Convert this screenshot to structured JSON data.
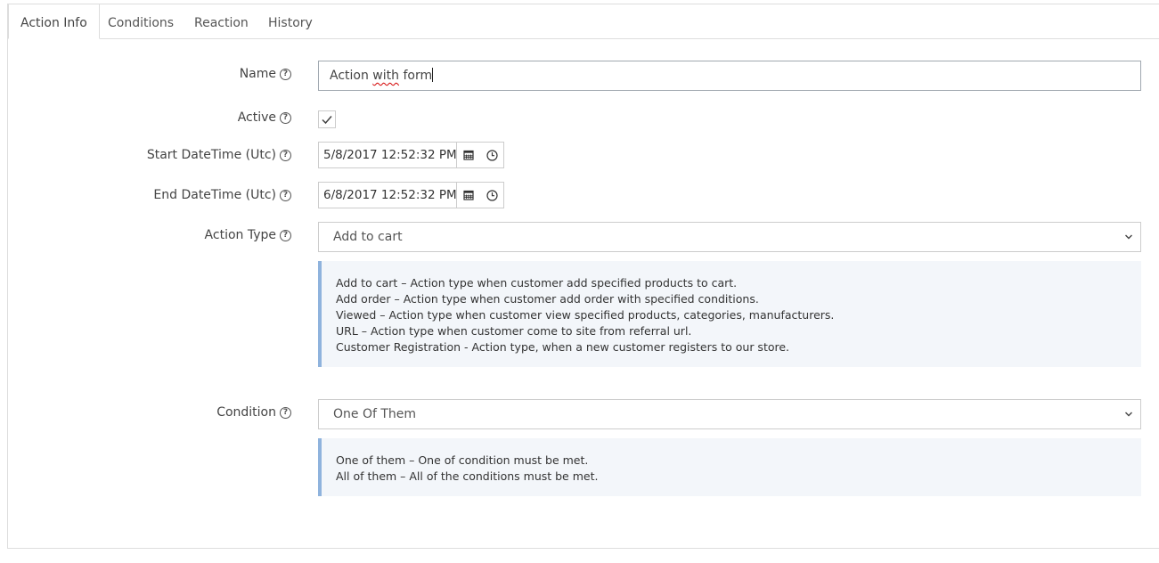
{
  "tabs": [
    {
      "label": "Action Info",
      "active": true
    },
    {
      "label": "Conditions",
      "active": false
    },
    {
      "label": "Reaction",
      "active": false
    },
    {
      "label": "History",
      "active": false
    }
  ],
  "form": {
    "name": {
      "label": "Name",
      "value_prefix": "Action ",
      "value_misspelled": "with",
      "value_suffix": " form"
    },
    "active": {
      "label": "Active",
      "checked": true
    },
    "start_datetime": {
      "label": "Start DateTime (Utc)",
      "value": "5/8/2017 12:52:32 PM"
    },
    "end_datetime": {
      "label": "End DateTime (Utc)",
      "value": "6/8/2017 12:52:32 PM"
    },
    "action_type": {
      "label": "Action Type",
      "selected": "Add to cart",
      "hint_lines": [
        "Add to cart – Action type when customer add specified products to cart.",
        "Add order – Action type when customer add order with specified conditions.",
        "Viewed – Action type when customer view specified products, categories, manufacturers.",
        "URL – Action type when customer come to site from referral url.",
        "Customer Registration - Action type, when a new customer registers to our store."
      ]
    },
    "condition": {
      "label": "Condition",
      "selected": "One Of Them",
      "hint_lines": [
        "One of them – One of condition must be met.",
        "All of them – All of the conditions must be met."
      ]
    }
  },
  "icons": {
    "help": "question-circle-icon",
    "calendar": "calendar-icon",
    "clock": "clock-icon",
    "chevron": "chevron-down-icon",
    "check": "checkmark-icon"
  },
  "colors": {
    "hint_border": "#8fb3dd",
    "hint_background": "#f3f6fa",
    "border": "#dddddd"
  }
}
